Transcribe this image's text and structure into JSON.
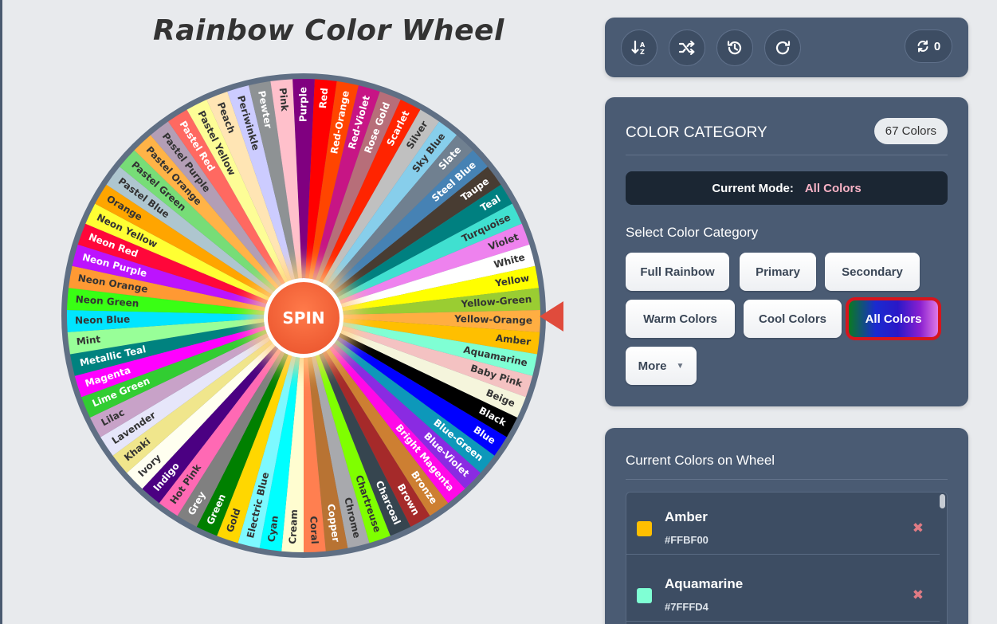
{
  "title": "Rainbow Color Wheel",
  "spin_label": "SPIN",
  "wheel": {
    "segments": [
      {
        "name": "Purple",
        "color": "#800080"
      },
      {
        "name": "Red",
        "color": "#FF0000"
      },
      {
        "name": "Red-Orange",
        "color": "#FF4500"
      },
      {
        "name": "Red-Violet",
        "color": "#C71585"
      },
      {
        "name": "Rose Gold",
        "color": "#B76E79"
      },
      {
        "name": "Scarlet",
        "color": "#FF2400"
      },
      {
        "name": "Silver",
        "color": "#C0C0C0"
      },
      {
        "name": "Sky Blue",
        "color": "#87CEEB"
      },
      {
        "name": "Slate",
        "color": "#708090"
      },
      {
        "name": "Steel Blue",
        "color": "#4682B4"
      },
      {
        "name": "Taupe",
        "color": "#483C32"
      },
      {
        "name": "Teal",
        "color": "#008080"
      },
      {
        "name": "Turquoise",
        "color": "#40E0D0"
      },
      {
        "name": "Violet",
        "color": "#EE82EE"
      },
      {
        "name": "White",
        "color": "#FFFFFF"
      },
      {
        "name": "Yellow",
        "color": "#FFFF00"
      },
      {
        "name": "Yellow-Green",
        "color": "#9ACD32"
      },
      {
        "name": "Yellow-Orange",
        "color": "#FFAE42"
      },
      {
        "name": "Amber",
        "color": "#FFBF00"
      },
      {
        "name": "Aquamarine",
        "color": "#7FFFD4"
      },
      {
        "name": "Baby Pink",
        "color": "#F4C2C2"
      },
      {
        "name": "Beige",
        "color": "#F5F5DC"
      },
      {
        "name": "Black",
        "color": "#000000"
      },
      {
        "name": "Blue",
        "color": "#0000FF"
      },
      {
        "name": "Blue-Green",
        "color": "#0D98BA"
      },
      {
        "name": "Blue-Violet",
        "color": "#8A2BE2"
      },
      {
        "name": "Bright Magenta",
        "color": "#FF08E8"
      },
      {
        "name": "Bronze",
        "color": "#CD7F32"
      },
      {
        "name": "Brown",
        "color": "#A52A2A"
      },
      {
        "name": "Charcoal",
        "color": "#36454F"
      },
      {
        "name": "Chartreuse",
        "color": "#7FFF00"
      },
      {
        "name": "Chrome",
        "color": "#A8A9AD"
      },
      {
        "name": "Copper",
        "color": "#B87333"
      },
      {
        "name": "Coral",
        "color": "#FF7F50"
      },
      {
        "name": "Cream",
        "color": "#FFFDD0"
      },
      {
        "name": "Cyan",
        "color": "#00FFFF"
      },
      {
        "name": "Electric Blue",
        "color": "#7DF9FF"
      },
      {
        "name": "Gold",
        "color": "#FFD700"
      },
      {
        "name": "Green",
        "color": "#008000"
      },
      {
        "name": "Grey",
        "color": "#808080"
      },
      {
        "name": "Hot Pink",
        "color": "#FF69B4"
      },
      {
        "name": "Indigo",
        "color": "#4B0082"
      },
      {
        "name": "Ivory",
        "color": "#FFFFF0"
      },
      {
        "name": "Khaki",
        "color": "#F0E68C"
      },
      {
        "name": "Lavender",
        "color": "#E6E6FA"
      },
      {
        "name": "Lilac",
        "color": "#C8A2C8"
      },
      {
        "name": "Lime Green",
        "color": "#32CD32"
      },
      {
        "name": "Magenta",
        "color": "#FF00FF"
      },
      {
        "name": "Metallic Teal",
        "color": "#00827F"
      },
      {
        "name": "Mint",
        "color": "#98FF98"
      },
      {
        "name": "Neon Blue",
        "color": "#00E5FF"
      },
      {
        "name": "Neon Green",
        "color": "#39FF14"
      },
      {
        "name": "Neon Orange",
        "color": "#FF9933"
      },
      {
        "name": "Neon Purple",
        "color": "#BC13FE"
      },
      {
        "name": "Neon Red",
        "color": "#FF073A"
      },
      {
        "name": "Neon Yellow",
        "color": "#FFFF33"
      },
      {
        "name": "Orange",
        "color": "#FFA500"
      },
      {
        "name": "Pastel Blue",
        "color": "#AEC6CF"
      },
      {
        "name": "Pastel Green",
        "color": "#77DD77"
      },
      {
        "name": "Pastel Orange",
        "color": "#FFB347"
      },
      {
        "name": "Pastel Purple",
        "color": "#B39EB5"
      },
      {
        "name": "Pastel Red",
        "color": "#FF6961"
      },
      {
        "name": "Pastel Yellow",
        "color": "#FDFD96"
      },
      {
        "name": "Peach",
        "color": "#FFE5B4"
      },
      {
        "name": "Periwinkle",
        "color": "#CCCCFF"
      },
      {
        "name": "Pewter",
        "color": "#8E9294"
      },
      {
        "name": "Pink",
        "color": "#FFC0CB"
      }
    ]
  },
  "toolbar": {
    "buttons": [
      {
        "name": "sort-icon",
        "label": "Sort"
      },
      {
        "name": "shuffle-icon",
        "label": "Shuffle"
      },
      {
        "name": "history-icon",
        "label": "History"
      },
      {
        "name": "redo-icon",
        "label": "Reset"
      }
    ],
    "spin_count_icon": "refresh-icon",
    "spin_count": "0"
  },
  "category": {
    "title": "COLOR CATEGORY",
    "count_badge": "67 Colors",
    "mode_label": "Current Mode:",
    "mode_value": "All Colors",
    "select_label": "Select Color Category",
    "buttons": [
      "Full Rainbow",
      "Primary",
      "Secondary",
      "Warm Colors",
      "Cool Colors",
      "All Colors",
      "More"
    ],
    "active": "All Colors"
  },
  "current": {
    "title": "Current Colors on Wheel",
    "items": [
      {
        "name": "Amber",
        "hex": "#FFBF00"
      },
      {
        "name": "Aquamarine",
        "hex": "#7FFFD4"
      }
    ],
    "remove_symbol": "✖"
  }
}
